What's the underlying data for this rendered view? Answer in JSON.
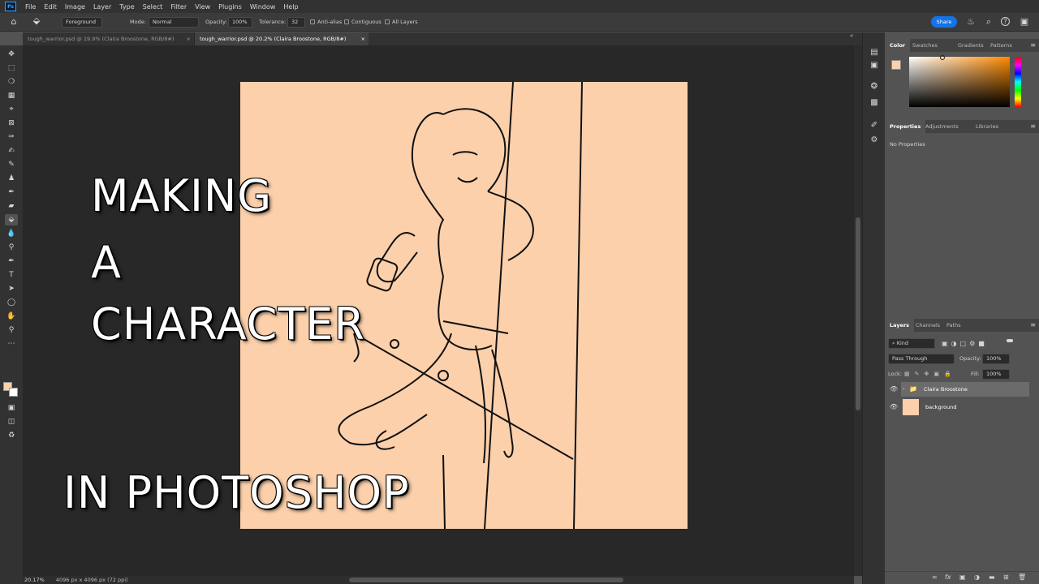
{
  "menu": [
    "File",
    "Edit",
    "Image",
    "Layer",
    "Type",
    "Select",
    "Filter",
    "View",
    "Plugins",
    "Window",
    "Help"
  ],
  "logo": "Ps",
  "options": {
    "fill_source": "Foreground",
    "mode_label": "Mode:",
    "mode_value": "Normal",
    "opacity_label": "Opacity:",
    "opacity_value": "100%",
    "tolerance_label": "Tolerance:",
    "tolerance_value": "32",
    "antialias_label": "Anti-alias",
    "contiguous_label": "Contiguous",
    "all_layers_label": "All Layers",
    "share_label": "Share"
  },
  "tabs": [
    {
      "label": "tough_warrior.psd @ 19.9% (Claira Broostone, RGB/8#)",
      "close": "×"
    },
    {
      "label": "tough_warrior.psd @ 20.2% (Claira Broostone, RGB/8#)",
      "close": "×"
    }
  ],
  "canvas": {
    "line1": "MAKING",
    "line2": "A",
    "line3": "CHARACTER",
    "line4": "IN PHOTOSHOP",
    "artboard_color": "#fbd0ab"
  },
  "status": {
    "zoom": "20.17%",
    "doc_size": "4096 px x 4096 px (72 ppi)"
  },
  "color_panel": {
    "tabs": [
      "Color",
      "Swatches",
      "Gradients",
      "Patterns"
    ],
    "foreground": "#fbd0ab",
    "hue": "#ff8a00"
  },
  "properties_panel": {
    "tabs": [
      "Properties",
      "Adjustments",
      "Libraries"
    ],
    "empty_text": "No Properties"
  },
  "layers_panel": {
    "tabs": [
      "Layers",
      "Channels",
      "Paths"
    ],
    "kind_label": "Kind",
    "blend_mode": "Pass Through",
    "opacity_label": "Opacity:",
    "opacity_value": "100%",
    "lock_label": "Lock:",
    "fill_label": "Fill:",
    "fill_value": "100%",
    "layers": [
      {
        "name": "Claira Broostone",
        "type": "group"
      },
      {
        "name": "background",
        "type": "pixel",
        "color": "#fbd0ab"
      }
    ],
    "footer_icons": [
      "link-icon",
      "fx-icon",
      "mask-icon",
      "adjustment-icon",
      "folder-icon",
      "new-layer-icon",
      "trash-icon"
    ],
    "fx_label": "fx"
  },
  "icons": {
    "home": "⌂",
    "bucket": "⬙",
    "search": "⌕",
    "bell": "🔔",
    "help": "?",
    "gear": "⚙",
    "kebab": "≡"
  }
}
